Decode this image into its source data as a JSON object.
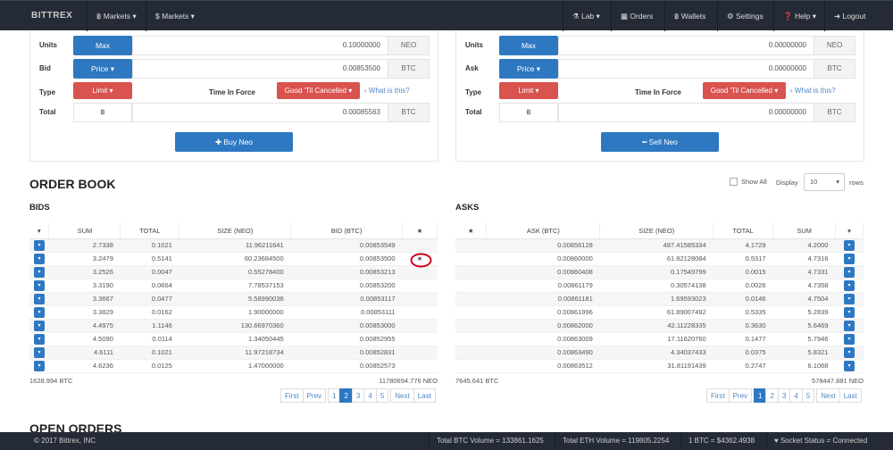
{
  "nav": {
    "brand": "BITTREX",
    "items": [
      "฿ Markets ▾",
      "$ Markets ▾",
      "⚗ Lab ▾",
      "▦ Orders",
      "฿ Wallets",
      "⚙ Settings",
      "❓ Help ▾",
      "➜ Logout"
    ]
  },
  "buy": {
    "units_label": "Units",
    "max": "Max",
    "units": "0.10000000",
    "units_cur": "NEO",
    "bid_label": "Bid",
    "price": "Price ▾",
    "bid": "0.00853500",
    "bid_cur": "BTC",
    "type_label": "Type",
    "type": "Limit ▾",
    "tif_label": "Time In Force",
    "tif": "Good 'Til Cancelled ▾",
    "help": "‹ What is this?",
    "total_label": "Total",
    "btc_sym": "฿",
    "total": "0.00085563",
    "total_cur": "BTC",
    "submit": "✚ Buy Neo"
  },
  "sell": {
    "units_label": "Units",
    "max": "Max",
    "units": "0.00000000",
    "units_cur": "NEO",
    "ask_label": "Ask",
    "price": "Price ▾",
    "ask": "0.00000000",
    "ask_cur": "BTC",
    "type_label": "Type",
    "type": "Limit ▾",
    "tif_label": "Time In Force",
    "tif": "Good 'Til Cancelled ▾",
    "help": "‹ What is this?",
    "total_label": "Total",
    "btc_sym": "฿",
    "total": "0.00000000",
    "total_cur": "BTC",
    "submit": "━ Sell Neo"
  },
  "orderbook": {
    "title": "ORDER BOOK",
    "show_all": "Show All",
    "display": "Display",
    "display_value": "10",
    "rows": "rows"
  },
  "bids": {
    "title": "BIDS",
    "headers": [
      "▾",
      "SUM",
      "TOTAL",
      "SIZE (NEO)",
      "BID (BTC)",
      "★"
    ],
    "rows": [
      [
        "2.7338",
        "0.1021",
        "11.96211641",
        "0.00853549",
        ""
      ],
      [
        "3.2479",
        "0.5141",
        "60.23684500",
        "0.00853500",
        "★"
      ],
      [
        "3.2526",
        "0.0047",
        "0.55278400",
        "0.00853213",
        ""
      ],
      [
        "3.3190",
        "0.0664",
        "7.78537153",
        "0.00853200",
        ""
      ],
      [
        "3.3667",
        "0.0477",
        "5.58990036",
        "0.00853117",
        ""
      ],
      [
        "3.3829",
        "0.0162",
        "1.90000000",
        "0.00853111",
        ""
      ],
      [
        "4.4975",
        "1.1146",
        "130.66970360",
        "0.00853000",
        ""
      ],
      [
        "4.5090",
        "0.0114",
        "1.34050445",
        "0.00852955",
        ""
      ],
      [
        "4.6111",
        "0.1021",
        "11.97218734",
        "0.00852831",
        ""
      ],
      [
        "4.6236",
        "0.0125",
        "1.47000000",
        "0.00852573",
        ""
      ]
    ],
    "total_btc": "1628.994 BTC",
    "total_neo": "11780694.776 NEO",
    "pages": [
      "First",
      "Prev",
      "1",
      "2",
      "3",
      "4",
      "5",
      "Next",
      "Last"
    ],
    "active_page": "2"
  },
  "asks": {
    "title": "ASKS",
    "headers": [
      "★",
      "ASK (BTC)",
      "SIZE (NEO)",
      "TOTAL",
      "SUM",
      "▾"
    ],
    "rows": [
      [
        "0.00856128",
        "487.41585334",
        "4.1729",
        "4.2000"
      ],
      [
        "0.00860000",
        "61.82128084",
        "0.5317",
        "4.7316"
      ],
      [
        "0.00860408",
        "0.17549799",
        "0.0015",
        "4.7331"
      ],
      [
        "0.00861179",
        "0.30574138",
        "0.0026",
        "4.7358"
      ],
      [
        "0.00861181",
        "1.69593023",
        "0.0146",
        "4.7504"
      ],
      [
        "0.00861996",
        "61.89007492",
        "0.5335",
        "5.2839"
      ],
      [
        "0.00862000",
        "42.11228335",
        "0.3630",
        "5.6469"
      ],
      [
        "0.00863009",
        "17.11620760",
        "0.1477",
        "5.7946"
      ],
      [
        "0.00863490",
        "4.34037433",
        "0.0375",
        "5.8321"
      ],
      [
        "0.00863512",
        "31.81191439",
        "0.2747",
        "6.1068"
      ]
    ],
    "total_btc": "7645.641 BTC",
    "total_neo": "578447.881 NEO",
    "pages": [
      "First",
      "Prev",
      "1",
      "2",
      "3",
      "4",
      "5",
      "Next",
      "Last"
    ],
    "active_page": "1"
  },
  "open_orders": {
    "title": "OPEN ORDERS"
  },
  "footer": {
    "copyright": "© 2017 Bittrex, INC",
    "btc_volume": "Total BTC Volume = 133861.1625",
    "eth_volume": "Total ETH Volume = 119805.2254",
    "btc_price": "1 BTC = $4362.4938",
    "socket": "♥ Socket Status = Connected"
  },
  "colors": {
    "nav": "#252b36",
    "primary": "#2e78c2",
    "danger": "#d9534f",
    "highlight_circle": "#d0021b"
  }
}
